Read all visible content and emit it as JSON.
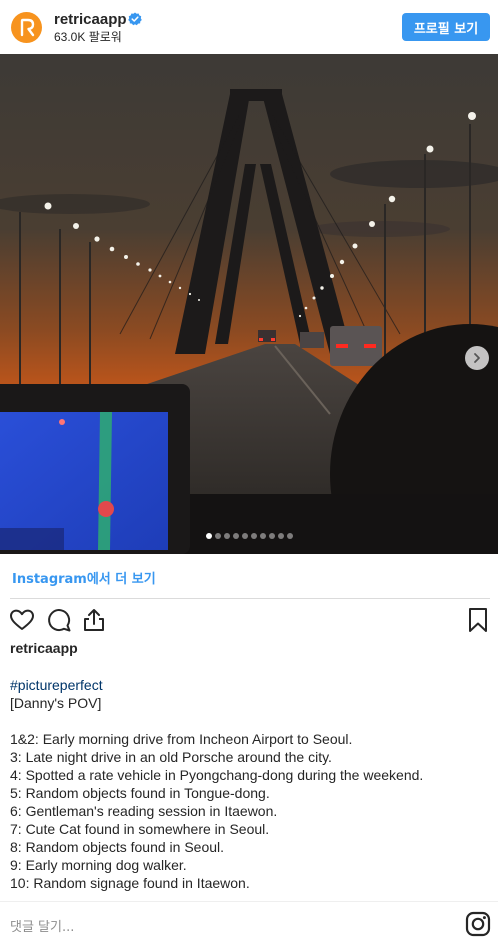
{
  "header": {
    "username": "retricaapp",
    "followers": "63.0K 팔로워",
    "profile_button": "프로필 보기",
    "avatar_icon": "retrica-logo-icon",
    "verified_icon": "verified-badge-icon"
  },
  "carousel": {
    "total_slides": 10,
    "active_index": 0,
    "next_icon": "chevron-right-icon"
  },
  "more_link": "Instagram에서 더 보기",
  "actions": {
    "like_icon": "heart-icon",
    "comment_icon": "comment-icon",
    "share_icon": "share-icon",
    "save_icon": "bookmark-icon"
  },
  "caption": {
    "username": "retricaapp",
    "hashtag": "#pictureperfect",
    "subtitle": "[Danny's POV]",
    "lines": [
      "1&2: Early morning drive from Incheon Airport to Seoul.",
      "3: Late night drive in an old Porsche around the city.",
      "4: Spotted a rate vehicle in Pyongchang-dong during the weekend.",
      "5: Random objects found in Tongue-dong.",
      "6: Gentleman's reading session in Itaewon.",
      "7: Cute Cat found in somewhere in Seoul.",
      "8: Random objects found in Seoul.",
      "9: Early morning dog walker.",
      "10: Random signage found in Itaewon."
    ]
  },
  "comment_placeholder": "댓글 달기...",
  "footer_icon": "instagram-icon",
  "colors": {
    "accent": "#3897f0",
    "avatar": "#f7931e",
    "hashtag": "#003569"
  }
}
